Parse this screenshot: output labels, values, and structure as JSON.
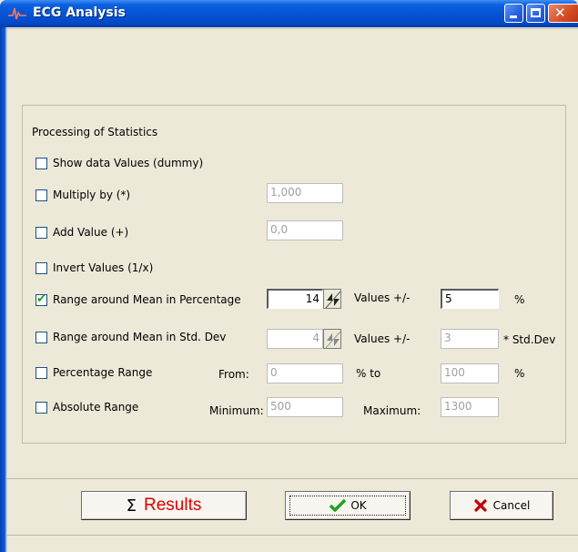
{
  "window": {
    "title": "ECG Analysis",
    "icon": "ecg-wave-icon",
    "controls": [
      "minimize-icon",
      "maximize-icon",
      "close-icon"
    ]
  },
  "group": {
    "title": "Processing of Statistics"
  },
  "options": {
    "show_data": {
      "label": "Show data Values (dummy)",
      "checked": false
    },
    "multiply": {
      "label": "Multiply by (*)",
      "checked": false,
      "value": "1,000"
    },
    "add": {
      "label": "Add Value (+)",
      "checked": false,
      "value": "0,0"
    },
    "invert": {
      "label": "Invert Values (1/x)",
      "checked": false
    },
    "range_pct": {
      "label": "Range around Mean in Percentage",
      "checked": true,
      "spin_value": "14",
      "values_label": "Values +/-",
      "values_value": "5",
      "unit": "%"
    },
    "range_std": {
      "label": "Range around Mean in Std. Dev",
      "checked": false,
      "spin_value": "4",
      "values_label": "Values +/-",
      "values_value": "3",
      "unit": "* Std.Dev"
    },
    "pct_range": {
      "label": "Percentage Range",
      "checked": false,
      "from_label": "From:",
      "from_value": "0",
      "mid_label": "%  to",
      "to_value": "100",
      "unit": "%"
    },
    "abs_range": {
      "label": "Absolute Range",
      "checked": false,
      "min_label": "Minimum:",
      "min_value": "500",
      "max_label": "Maximum:",
      "max_value": "1300"
    }
  },
  "buttons": {
    "results": {
      "symbol": "Σ",
      "label": "Results"
    },
    "ok": {
      "label": "OK",
      "icon": "checkmark-icon"
    },
    "cancel": {
      "label": "Cancel",
      "icon": "x-cross-icon"
    }
  },
  "colors": {
    "titlebar": "#0554d6",
    "results_text": "#e00000",
    "ok_check": "#21a121",
    "cancel_x": "#c00000"
  }
}
